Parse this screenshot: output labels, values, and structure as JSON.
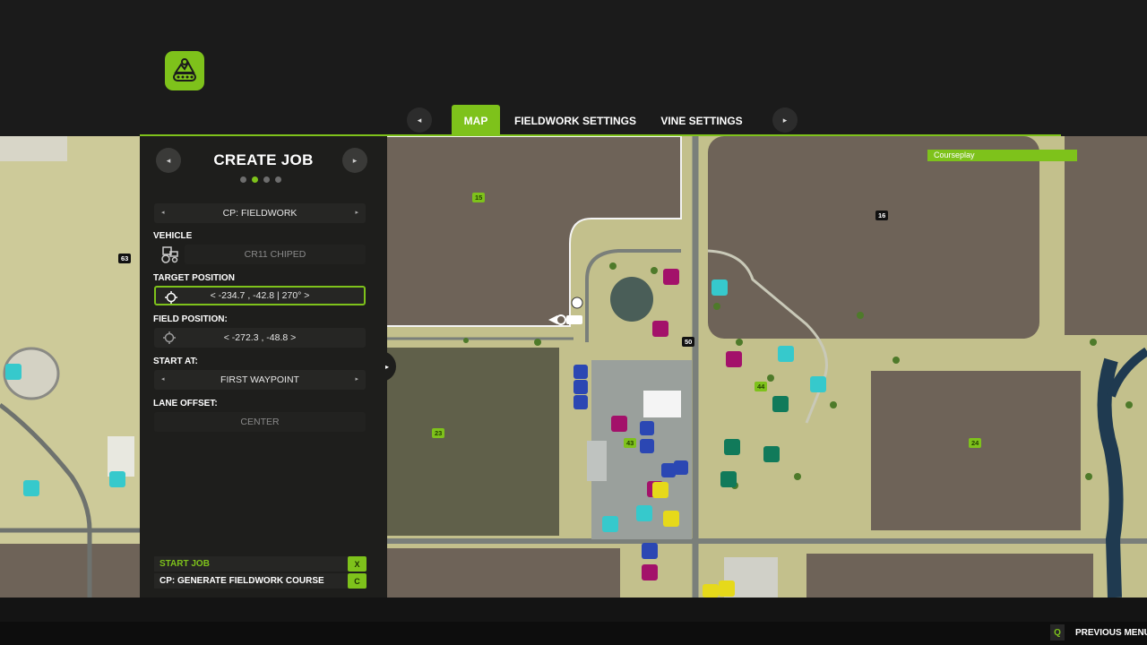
{
  "tabs": {
    "prev_arrow": "◂",
    "next_arrow": "▸",
    "items": [
      {
        "label": "MAP"
      },
      {
        "label": "FIELDWORK SETTINGS"
      },
      {
        "label": "VINE SETTINGS"
      }
    ]
  },
  "panel": {
    "title": "CREATE JOB",
    "prev_arrow": "◂",
    "next_arrow": "▸",
    "page_count": 4,
    "active_page": 2,
    "job_type": {
      "value": "CP: FIELDWORK"
    },
    "vehicle": {
      "label": "VEHICLE",
      "value": "CR11 CHIPED"
    },
    "target_position": {
      "label": "TARGET POSITION",
      "value": "< -234.7 , -42.8 | 270° >"
    },
    "field_position": {
      "label": "FIELD POSITION:",
      "value": "< -272.3 , -48.8 >"
    },
    "start_at": {
      "label": "START AT:",
      "value": "FIRST WAYPOINT"
    },
    "lane_offset": {
      "label": "LANE OFFSET:",
      "value": "CENTER"
    },
    "actions": [
      {
        "label": "START JOB",
        "key": "X"
      },
      {
        "label": "CP: GENERATE FIELDWORK COURSE",
        "key": "C"
      }
    ],
    "collapse_arrow": "▸"
  },
  "map": {
    "courseplay_label": "Courseplay",
    "field_numbers": [
      "15",
      "16",
      "63",
      "50",
      "44",
      "43",
      "23",
      "24"
    ]
  },
  "footer": {
    "key": "Q",
    "label": "PREVIOUS MENU"
  },
  "colors": {
    "accent": "#7ec21b",
    "panel_bg": "#1e1e1c",
    "field_brown": "#6e6358",
    "grass": "#c9c697",
    "road": "#7a7f7a"
  }
}
